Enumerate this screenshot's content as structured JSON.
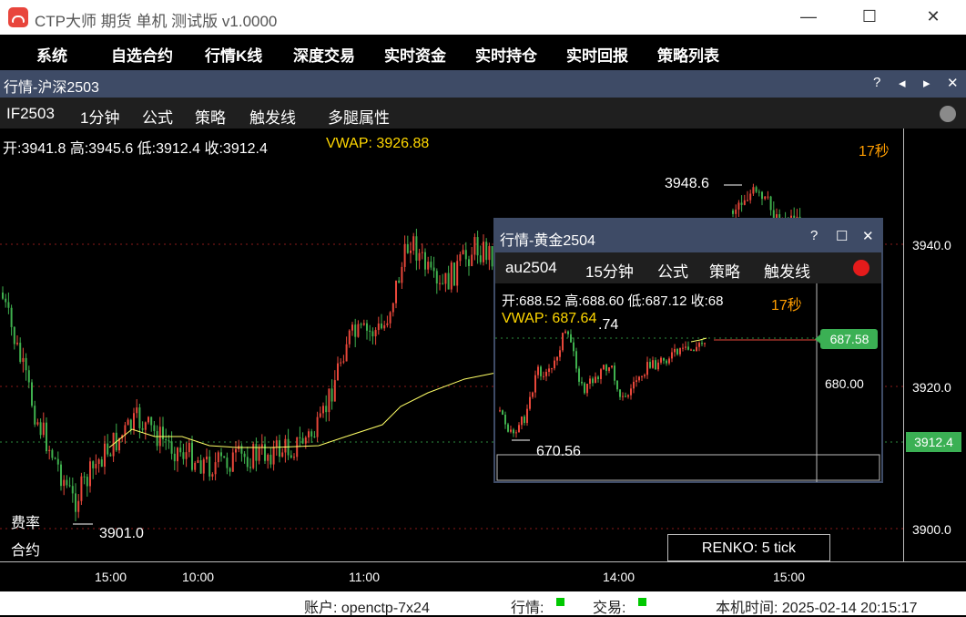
{
  "app": {
    "title": "CTP大师 期货 单机 测试版 v1.0000"
  },
  "window_controls": {
    "minimize": "—",
    "maximize": "☐",
    "close": "✕"
  },
  "menu": [
    "系统",
    "自选合约",
    "行情K线",
    "深度交易",
    "实时资金",
    "实时持仓",
    "实时回报",
    "策略列表"
  ],
  "panel": {
    "title": "行情-沪深2503",
    "buttons": {
      "help": "?",
      "prev": "◂",
      "next": "▸",
      "close": "✕"
    },
    "toolbar": [
      "IF2503",
      "1分钟",
      "公式",
      "策略",
      "触发线",
      "多腿属性"
    ],
    "ohlc_text": "开:3941.8 高:3945.6 低:3912.4 收:3912.4",
    "vwap_text": "VWAP: 3926.88",
    "timer": "17秒",
    "high_label": "3948.6",
    "low_label": "3901.0",
    "left_labels": [
      "费率",
      "合约"
    ],
    "price_ticks": [
      "3940.0",
      "3920.0",
      "3900.0"
    ],
    "last_price": "3912.4",
    "time_ticks": [
      "15:00",
      "10:00",
      "11:00",
      "14:00",
      "15:00"
    ],
    "renko": "RENKO: 5 tick",
    "colors": {
      "up": "#e8473a",
      "down": "#3fb04e",
      "vwap_line": "#ffff66",
      "price_tag": "#3bb054",
      "gridline": "#8b1a1a"
    }
  },
  "sub_window": {
    "title": "行情-黄金2504",
    "buttons": {
      "help": "?",
      "maximize": "☐",
      "close": "✕"
    },
    "toolbar": [
      "au2504",
      "15分钟",
      "公式",
      "策略",
      "触发线"
    ],
    "ohlc_text": "开:688.52 高:688.60 低:687.12 收:68",
    "vwap_text": "VWAP: 687.64",
    "timer": "17秒",
    "high_label": ".74",
    "low_label": "670.56",
    "price_tick": "680.00",
    "last_price": "687.58",
    "status_color": "#e41b1b"
  },
  "status_bar": {
    "account": "账户: openctp-7x24",
    "quote_label": "行情:",
    "trade_label": "交易:",
    "local_time": "本机时间: 2025-02-14 20:15:17"
  }
}
